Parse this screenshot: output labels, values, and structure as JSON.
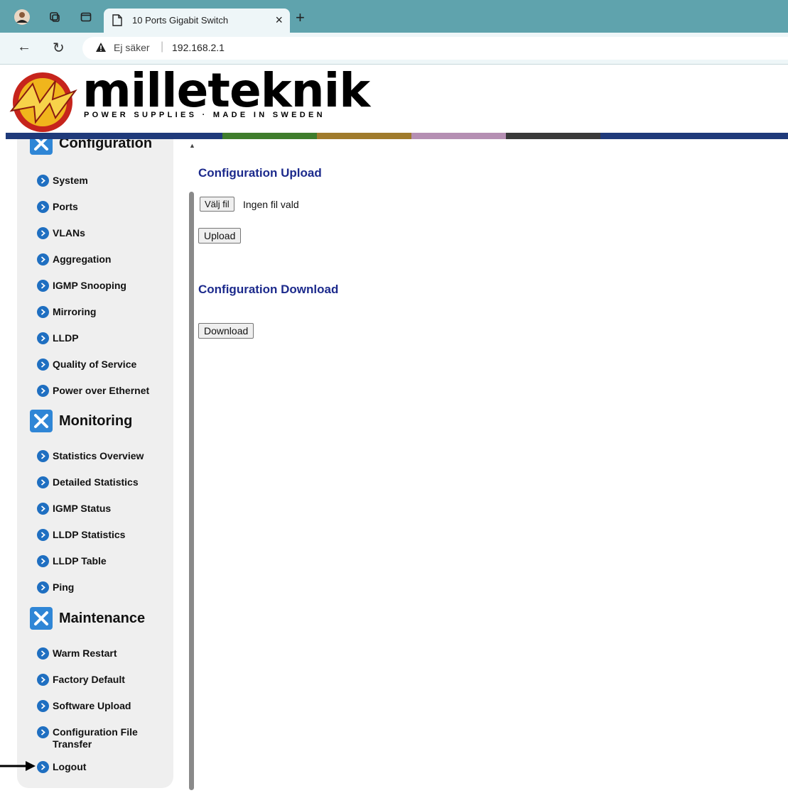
{
  "browser": {
    "tab_title": "10 Ports Gigabit Switch",
    "tab_close": "×",
    "new_tab": "+",
    "security_label": "Ej säker",
    "separator": "|",
    "url": "192.168.2.1"
  },
  "header": {
    "brand": "milleteknik",
    "tagline": "POWER SUPPLIES · MADE IN SWEDEN",
    "color_bar": [
      "#1f3a7a",
      "#3f7d2c",
      "#a07b2c",
      "#b58fb3",
      "#3a3a3a",
      "#1f3a7a"
    ]
  },
  "sidebar": {
    "sections": [
      {
        "title": "Configuration",
        "icon": "tools-icon",
        "items": [
          "System",
          "Ports",
          "VLANs",
          "Aggregation",
          "IGMP Snooping",
          "Mirroring",
          "LLDP",
          "Quality of Service",
          "Power over Ethernet"
        ]
      },
      {
        "title": "Monitoring",
        "icon": "tools-icon",
        "items": [
          "Statistics Overview",
          "Detailed Statistics",
          "IGMP Status",
          "LLDP Statistics",
          "LLDP Table",
          "Ping"
        ]
      },
      {
        "title": "Maintenance",
        "icon": "tools-icon",
        "items": [
          "Warm Restart",
          "Factory Default",
          "Software Upload",
          "Configuration File Transfer",
          "Logout"
        ]
      }
    ]
  },
  "main": {
    "upload_heading": "Configuration Upload",
    "choose_file_label": "Välj fil",
    "no_file_text": "Ingen fil vald",
    "upload_button": "Upload",
    "download_heading": "Configuration Download",
    "download_button": "Download"
  },
  "colors": {
    "tabstrip": "#5fa3ad",
    "heading": "#1c2a8c",
    "bullet": "#1f6fc1",
    "section_icon": "#2f86d6"
  }
}
